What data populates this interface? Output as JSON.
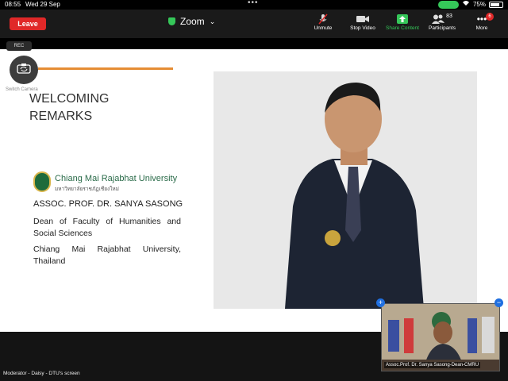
{
  "status_bar": {
    "time": "08:55",
    "date": "Wed 29 Sep",
    "battery": "75%"
  },
  "toolbar": {
    "leave_label": "Leave",
    "app_title": "Zoom",
    "unmute_label": "Unmute",
    "stop_video_label": "Stop Video",
    "share_content_label": "Share Content",
    "participants_label": "Participants",
    "participants_count": "83",
    "more_label": "More",
    "more_badge": "6"
  },
  "overlay": {
    "rec_label": "REC",
    "switch_camera_label": "Switch Camera"
  },
  "slide": {
    "title_line1": "WELCOMING",
    "title_line2": "REMARKS",
    "university_en": "Chiang Mai Rajabhat University",
    "university_th": "มหาวิทยาลัยราชภัฏเชียงใหม่",
    "speaker_name": "ASSOC. PROF. DR. SANYA SASONG",
    "speaker_role": "Dean of Faculty of Humanities and Social Sciences",
    "speaker_affiliation": "Chiang Mai Rajabhat University, Thailand"
  },
  "thumbnail": {
    "label": "Assoc.Prof. Dr. Sanya Sasong-Dean-CMRU",
    "add_symbol": "+",
    "minimize_symbol": "−"
  },
  "footer": {
    "screen_label": "Moderator - Daisy - DTU's screen"
  },
  "colors": {
    "leave": "#e02828",
    "share_green": "#35c759",
    "accent_orange": "#e58d34",
    "university_green": "#2a6b49"
  }
}
